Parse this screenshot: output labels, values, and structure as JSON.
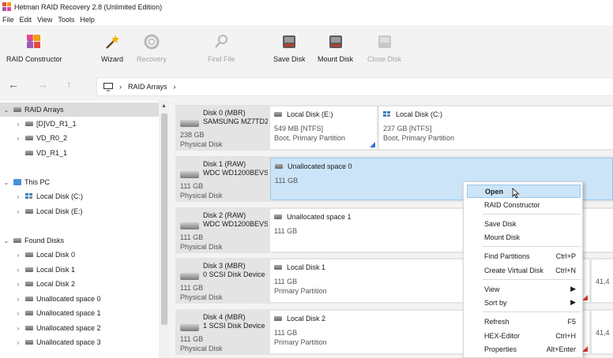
{
  "window": {
    "title": "Hetman RAID Recovery 2.8 (Unlimited Edition)"
  },
  "menu": [
    "File",
    "Edit",
    "View",
    "Tools",
    "Help"
  ],
  "toolbar": {
    "raid_constructor": "RAID Constructor",
    "wizard": "Wizard",
    "recovery": "Recovery",
    "find_file": "Find File",
    "save_disk": "Save Disk",
    "mount_disk": "Mount Disk",
    "close_disk": "Close Disk"
  },
  "address": {
    "segments": [
      "RAID Arrays"
    ]
  },
  "tree": {
    "raid_arrays": "RAID Arrays",
    "raid_items": [
      "[D]VD_R1_1",
      "VD_R0_2",
      "VD_R1_1"
    ],
    "this_pc": "This PC",
    "pc_items": [
      "Local Disk (C:)",
      "Local Disk (E:)"
    ],
    "found_disks": "Found Disks",
    "found_items": [
      "Local Disk 0",
      "Local Disk 1",
      "Local Disk 2",
      "Unallocated space 0",
      "Unallocated space 1",
      "Unallocated space 2",
      "Unallocated space 3"
    ]
  },
  "disks": [
    {
      "name": "Disk 0 (MBR)",
      "model": "SAMSUNG MZ7TD2",
      "size": "238 GB",
      "kind": "Physical Disk",
      "partitions": [
        {
          "title": "Local Disk (E:)",
          "l1": "549 MB [NTFS]",
          "l2": "Boot, Primary Partition"
        },
        {
          "title": "Local Disk (C:)",
          "l1": "237 GB [NTFS]",
          "l2": "Boot, Primary Partition"
        }
      ]
    },
    {
      "name": "Disk 1 (RAW)",
      "model": "WDC WD1200BEVS-",
      "size": "111 GB",
      "kind": "Physical Disk",
      "partitions": [
        {
          "title": "Unallocated space 0",
          "l1": "111 GB",
          "l2": ""
        }
      ]
    },
    {
      "name": "Disk 2 (RAW)",
      "model": "WDC WD1200BEVS-",
      "size": "111 GB",
      "kind": "Physical Disk",
      "partitions": [
        {
          "title": "Unallocated space 1",
          "l1": "111 GB",
          "l2": ""
        }
      ]
    },
    {
      "name": "Disk 3 (MBR)",
      "model": "0 SCSI Disk Device",
      "size": "111 GB",
      "kind": "Physical Disk",
      "partitions": [
        {
          "title": "Local Disk 1",
          "l1": "111 GB",
          "l2": "Primary Partition"
        }
      ],
      "edge": "41,4"
    },
    {
      "name": "Disk 4 (MBR)",
      "model": "1 SCSI Disk Device",
      "size": "111 GB",
      "kind": "Physical Disk",
      "partitions": [
        {
          "title": "Local Disk 2",
          "l1": "111 GB",
          "l2": "Primary Partition"
        }
      ],
      "edge": "41,4"
    }
  ],
  "context_menu": {
    "open": "Open",
    "raid_constructor": "RAID Constructor",
    "save_disk": "Save Disk",
    "mount_disk": "Mount Disk",
    "find_partitions": "Find Partitions",
    "find_partitions_key": "Ctrl+P",
    "create_virtual_disk": "Create Virtual Disk",
    "create_virtual_disk_key": "Ctrl+N",
    "view": "View",
    "sort_by": "Sort by",
    "refresh": "Refresh",
    "refresh_key": "F5",
    "hex_editor": "HEX-Editor",
    "hex_editor_key": "Ctrl+H",
    "properties": "Properties",
    "properties_key": "Alt+Enter"
  },
  "colors": {
    "selection": "#cce4f7",
    "accent_blue": "#2f6fd6",
    "accent_red": "#d83333"
  }
}
